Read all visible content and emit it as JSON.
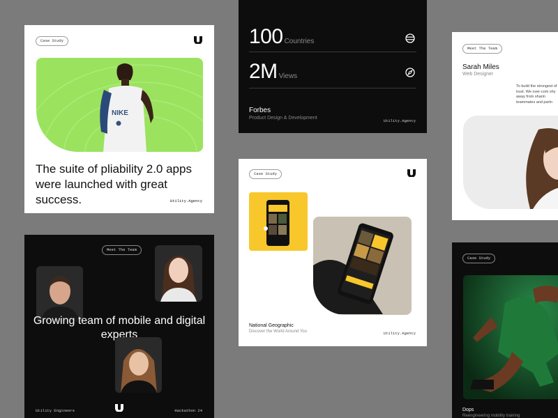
{
  "colors": {
    "background": "#7b7b7b",
    "lime": "#9be35f",
    "yellow": "#f8c72c",
    "green": "#1e7a3c"
  },
  "card1": {
    "badge": "Case Study",
    "headline": "The suite of pliability 2.0 apps were launched with great success.",
    "agency": "Utility.Agency",
    "shirt_text": "NIKE"
  },
  "card2": {
    "stat1": {
      "value": "100",
      "label": "Countries",
      "icon": "globe-icon"
    },
    "stat2": {
      "value": "2M",
      "label": "Views",
      "icon": "compass-icon"
    },
    "client": "Forbes",
    "service": "Product Design & Development",
    "agency": "Utility.Agency"
  },
  "card3": {
    "badge": "Meet The Team",
    "name": "Sarah Miles",
    "role": "Web Designer",
    "quote": "To build the strongest of trust. We over-com shy away from sharin teammates and partn"
  },
  "card4": {
    "badge": "Meet The Team",
    "headline": "Growing team of mobile and digital experts",
    "footer_left": "Utility Engineers",
    "footer_right": "Hackathon 24"
  },
  "card5": {
    "badge": "Case Study",
    "client": "National Geographic",
    "tagline": "Discover the World Around You",
    "agency": "Utility.Agency"
  },
  "card6": {
    "badge": "Case Study",
    "client": "Dops",
    "tagline": "Reengineering mobility training"
  }
}
